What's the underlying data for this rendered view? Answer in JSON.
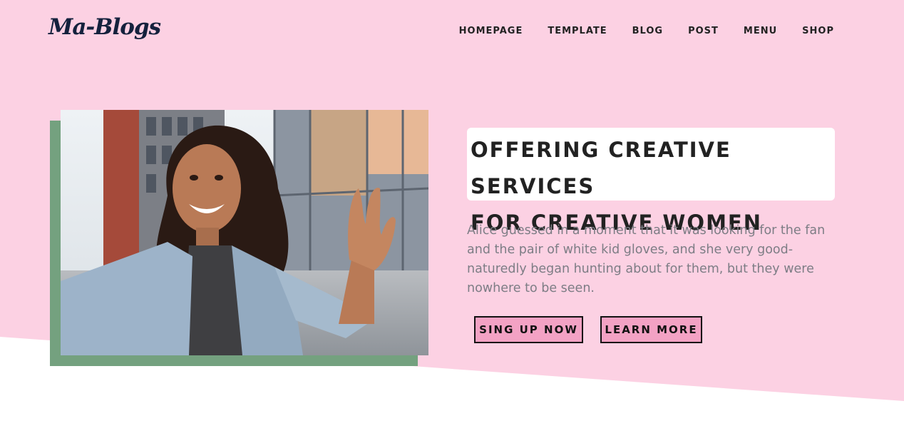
{
  "brand": {
    "logo_text": "Ma-Blogs"
  },
  "nav": {
    "items": [
      "HOMEPAGE",
      "TEMPLATE",
      "BLOG",
      "POST",
      "MENU",
      "SHOP"
    ]
  },
  "hero": {
    "headline_line1": "OFFERING CREATIVE SERVICES",
    "headline_line2": "FOR CREATIVE WOMEN",
    "body": "Alice guessed in a moment that it was looking for the fan and the pair of white kid gloves, and she very good-naturedly began hunting about for them, but they were nowhere to be seen.",
    "primary_button": "SING UP NOW",
    "secondary_button": "LEARN MORE",
    "image_alt": "smiling woman taking a selfie"
  },
  "colors": {
    "background_pink": "#fcd1e3",
    "accent_green": "#74a17f",
    "button_pink": "#f3a2c4",
    "logo_navy": "#14213d"
  }
}
